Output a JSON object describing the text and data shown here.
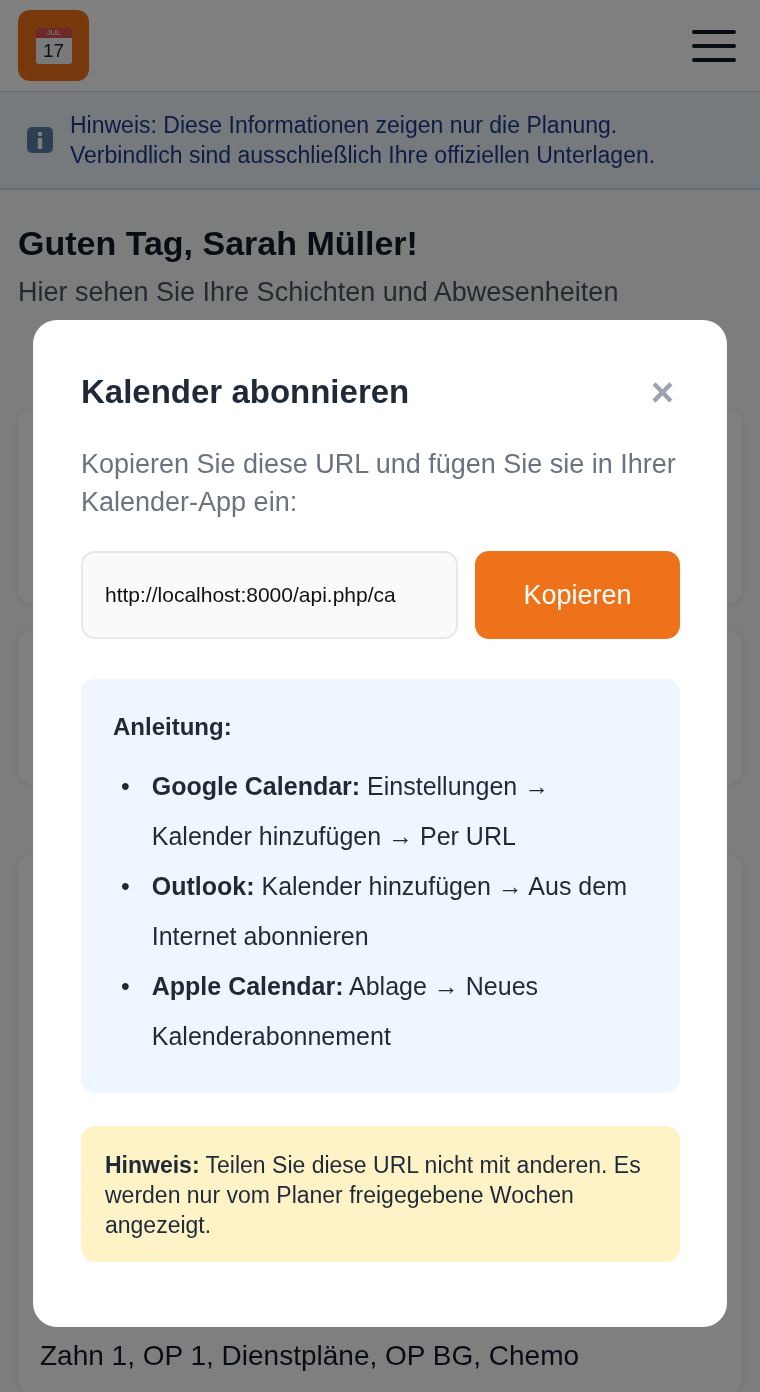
{
  "header": {
    "logo": {
      "month": "JUL",
      "day": "17"
    }
  },
  "notice": {
    "text": "Hinweis: Diese Informationen zeigen nur die Planung. Verbindlich sind ausschließlich Ihre offiziellen Unterlagen."
  },
  "greeting": "Guten Tag, Sarah Müller!",
  "subtitle": "Hier sehen Sie Ihre Schichten und Abwesenheiten",
  "card_text": "Zahn 1, OP 1, Dienstpläne, OP BG, Chemo",
  "modal": {
    "title": "Kalender abonnieren",
    "close": "×",
    "description": "Kopieren Sie diese URL und fügen Sie sie in Ihrer Kalender-App ein:",
    "url_field": {
      "value": "http://localhost:8000/api.php/ca"
    },
    "copy_button": "Kopieren",
    "instructions": {
      "heading": "Anleitung:",
      "items": [
        {
          "marker": "•",
          "text": "**Google Calendar:** Einstellungen → Kalender hinzufügen → Per URL"
        },
        {
          "marker": "•",
          "text": "**Outlook:** Kalender hinzufügen → Aus dem Internet abonnieren"
        },
        {
          "marker": "•",
          "text": "**Apple Calendar:** Ablage → Neues Kalenderabonnement"
        }
      ]
    },
    "warning": {
      "text": "**Hinweis:** Teilen Sie diese URL nicht mit anderen. Es werden nur vom Planer freigegebene Wochen angezeigt."
    }
  }
}
